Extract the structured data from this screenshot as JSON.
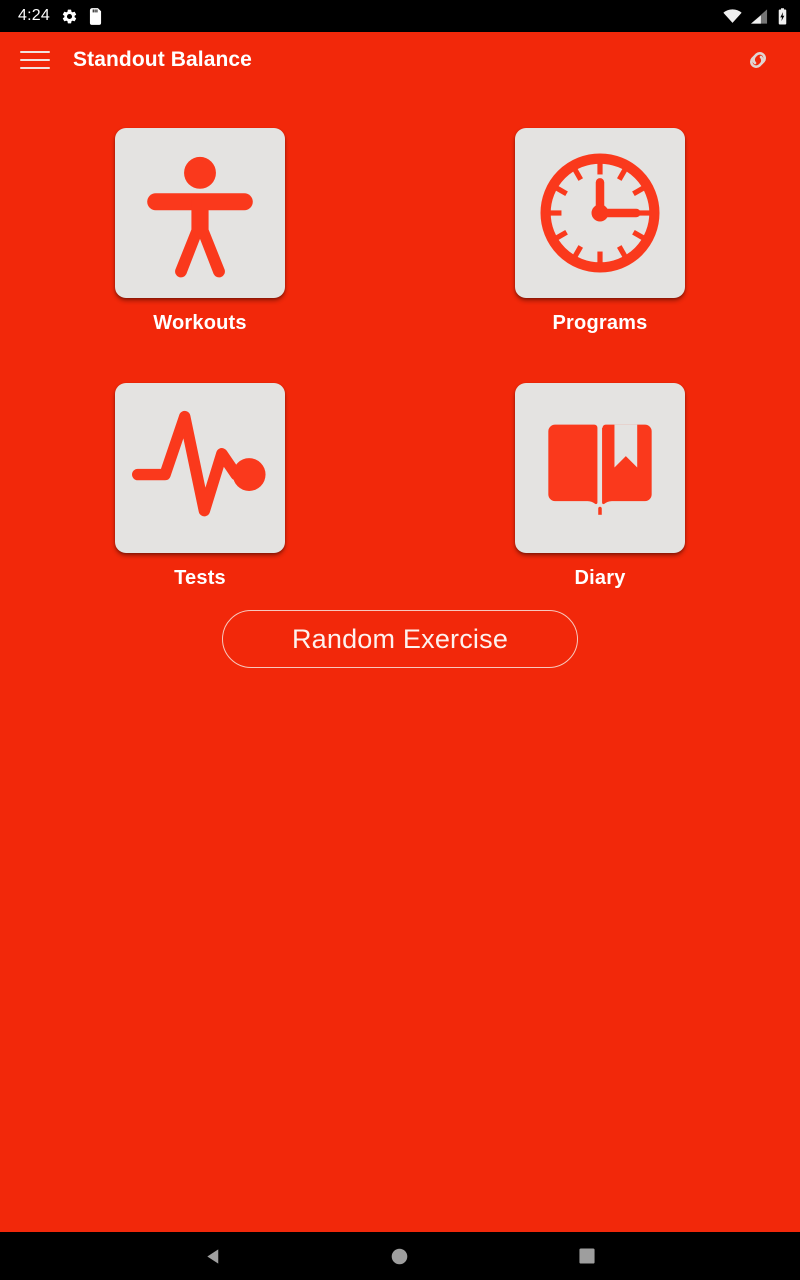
{
  "colors": {
    "background": "#F2280A",
    "app_bar": "#F2280A",
    "tile_card": "#E4E3E1",
    "icon_red": "#FA391C",
    "status_bar": "#000000",
    "nav_bar": "#000000",
    "nav_icon": "#9E9E9E",
    "label_text": "#FFFFFF",
    "button_border": "#F7C8BD"
  },
  "status_bar": {
    "time": "4:24",
    "icons_left": [
      "gear-icon",
      "sd-card-icon"
    ],
    "icons_right": [
      "wifi-icon",
      "cell-signal-icon",
      "battery-charging-icon"
    ]
  },
  "app_bar": {
    "menu_icon": "hamburger-menu-icon",
    "title": "Standout Balance",
    "action_icon": "link-icon"
  },
  "main": {
    "tiles": [
      {
        "label": "Workouts",
        "icon": "accessibility-person-icon"
      },
      {
        "label": "Programs",
        "icon": "clock-icon"
      },
      {
        "label": "Tests",
        "icon": "pulse-waveform-icon"
      },
      {
        "label": "Diary",
        "icon": "open-book-bookmark-icon"
      }
    ],
    "random_button": {
      "label": "Random Exercise"
    }
  },
  "nav_bar": {
    "buttons": [
      {
        "name": "back",
        "icon": "back-triangle-icon"
      },
      {
        "name": "home",
        "icon": "home-circle-icon"
      },
      {
        "name": "recents",
        "icon": "recents-square-icon"
      }
    ]
  }
}
